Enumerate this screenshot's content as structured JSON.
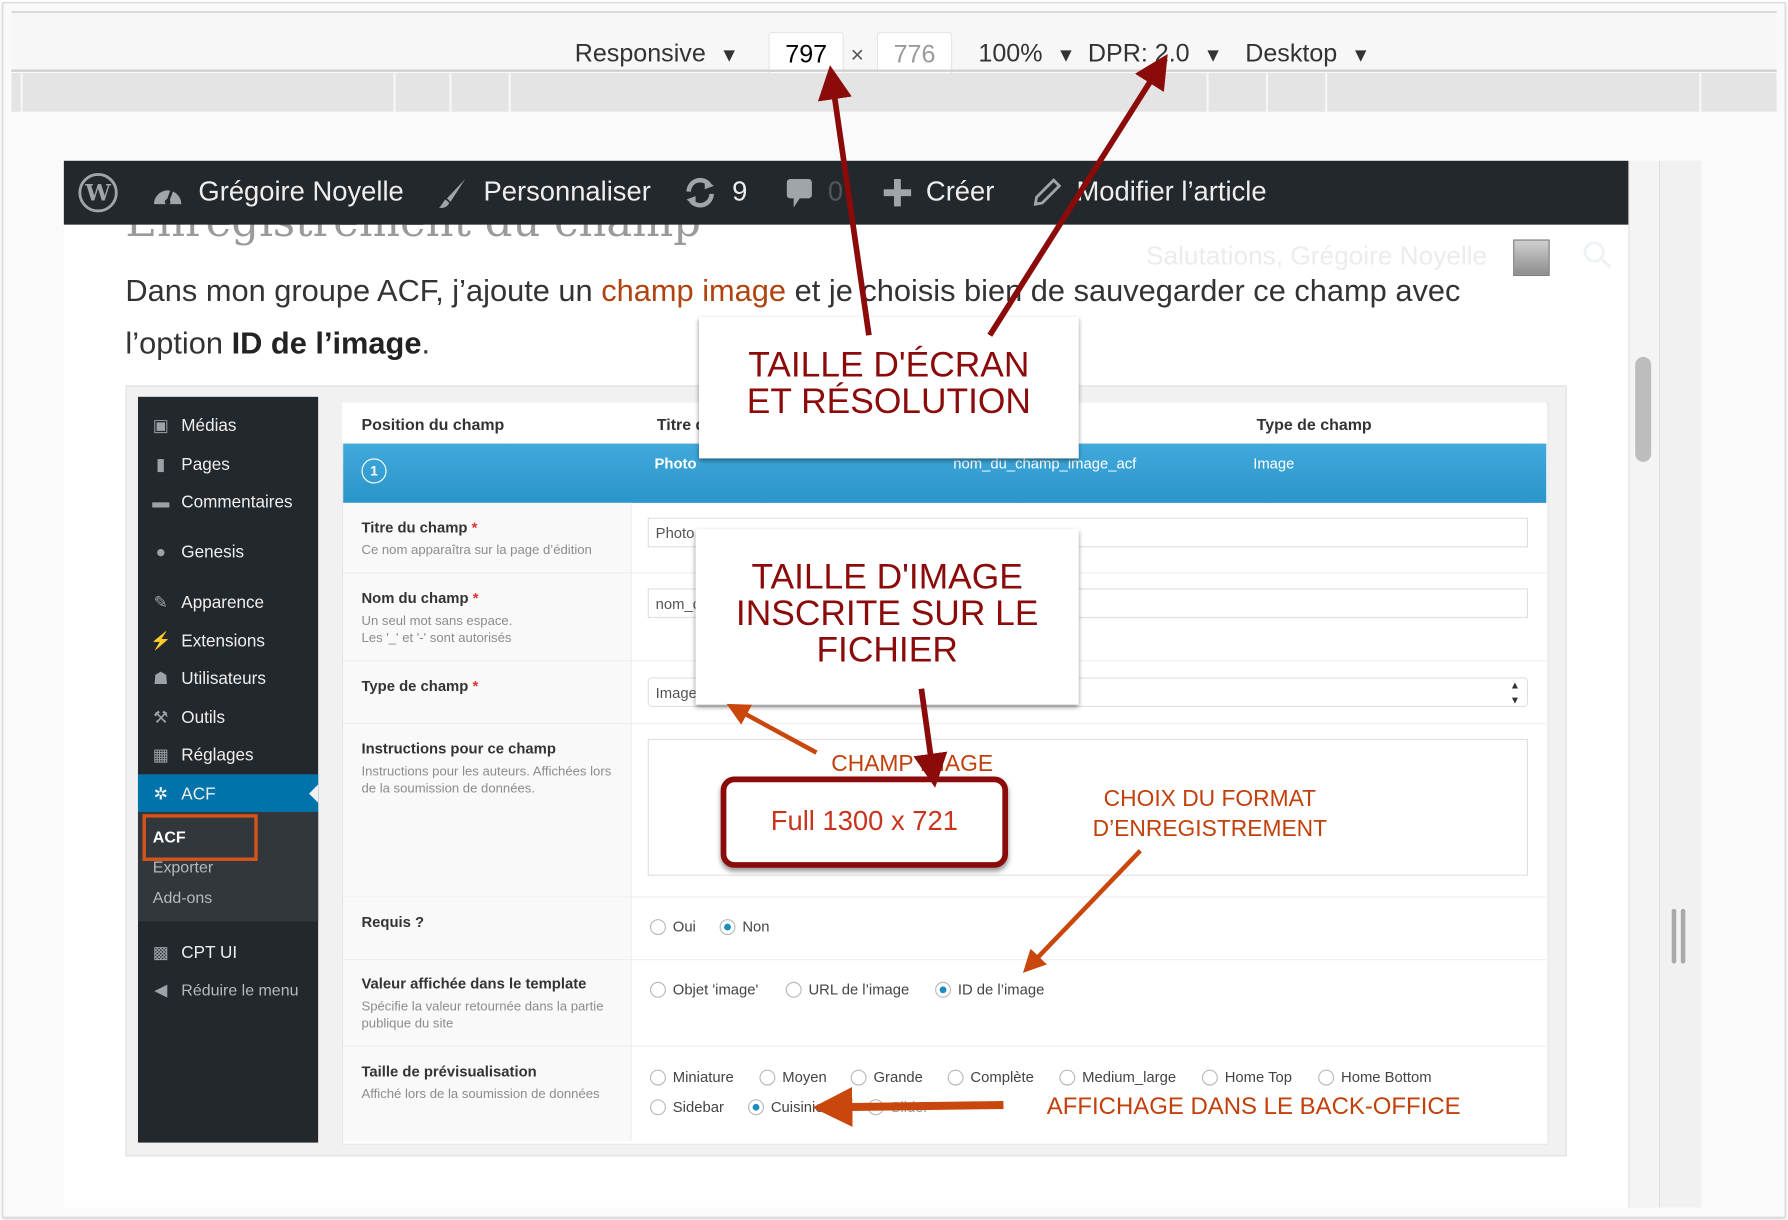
{
  "devtools": {
    "device_mode": "Responsive",
    "width_value": "797",
    "times_sign": "×",
    "height_value": "776",
    "zoom": "100%",
    "dpr": "DPR: 2.0",
    "device_type": "Desktop",
    "dropdown_glyph": "▼"
  },
  "adminbar": {
    "site_name": "Grégoire Noyelle",
    "customize": "Personnaliser",
    "updates_count": "9",
    "comments_count": "0",
    "new": "Créer",
    "edit": "Modifier l’article"
  },
  "article": {
    "heading": "Enregistrement du champ",
    "greeting": "Salutations, Grégoire Noyelle",
    "para_part1": "Dans mon groupe ACF, j’ajoute un ",
    "para_link": "champ image",
    "para_part2": " et je choisis bien de sauvegarder ce champ avec l’option ",
    "para_bold": "ID de l’image",
    "para_end": "."
  },
  "wp_menu": {
    "items": [
      {
        "label": "Médias",
        "icon": "media-icon"
      },
      {
        "label": "Pages",
        "icon": "pages-icon"
      },
      {
        "label": "Commentaires",
        "icon": "comments-icon"
      },
      {
        "label": "Genesis",
        "icon": "genesis-icon"
      },
      {
        "label": "Apparence",
        "icon": "appearance-icon"
      },
      {
        "label": "Extensions",
        "icon": "plugins-icon"
      },
      {
        "label": "Utilisateurs",
        "icon": "users-icon"
      },
      {
        "label": "Outils",
        "icon": "tools-icon"
      },
      {
        "label": "Réglages",
        "icon": "settings-icon"
      },
      {
        "label": "ACF",
        "icon": "gear-icon",
        "active": true
      }
    ],
    "submenu": [
      "ACF",
      "Exporter",
      "Add-ons"
    ],
    "cpt_ui": "CPT UI",
    "collapse": "Réduire le menu"
  },
  "acf": {
    "headers": [
      "Position du champ",
      "Titre du champ",
      "Type de champ"
    ],
    "field_row": {
      "order": "1",
      "title": "Photo",
      "name": "nom_du_champ_image_acf",
      "type": "Image"
    },
    "fields": {
      "title_label": "Titre du champ",
      "title_desc": "Ce nom apparaîtra sur la page d’édition",
      "title_value": "Photo",
      "name_label": "Nom du champ",
      "name_desc1": "Un seul mot sans espace.",
      "name_desc2": "Les '_' et '-' sont autorisés",
      "name_value": "nom_du_champ_image_acf",
      "type_label": "Type de champ",
      "type_value": "Image",
      "instructions_label": "Instructions pour ce champ",
      "instructions_desc": "Instructions pour les auteurs. Affichées lors de la soumission de données.",
      "required_label": "Requis ?",
      "required_options": [
        "Oui",
        "Non"
      ],
      "required_selected": "Non",
      "return_label": "Valeur affichée dans le template",
      "return_desc": "Spécifie la valeur retournée dans la partie publique du site",
      "return_options": [
        "Objet 'image'",
        "URL de l’image",
        "ID de l’image"
      ],
      "return_selected": "ID de l’image",
      "preview_label": "Taille de prévisualisation",
      "preview_desc": "Affiché lors de la soumission de données",
      "preview_options_row1": [
        "Miniature",
        "Moyen",
        "Grande",
        "Complète",
        "Medium_large",
        "Home Top",
        "Home Bottom"
      ],
      "preview_options_row2": [
        "Sidebar",
        "Cuisinier",
        "Slider"
      ],
      "preview_selected": "Cuisinier"
    }
  },
  "annotations": {
    "screen_size": "TAILLE D'ÉCRAN ET RÉSOLUTION",
    "image_size": "TAILLE D'IMAGE INSCRITE SUR LE FICHIER",
    "champ_image": "CHAMP IMAGE",
    "full_size": "Full 1300 x 721",
    "format_choice_1": "CHOIX DU FORMAT",
    "format_choice_2": "D’ENREGISTREMENT",
    "backoffice": "AFFICHAGE DANS LE BACK-OFFICE"
  },
  "colors": {
    "annotation_dark_red": "#8b0a0a",
    "annotation_orange": "#c2400b",
    "wp_admin_bar": "#23282d",
    "wp_active_blue": "#0073aa",
    "acf_row_blue": "#2a95c9",
    "link_color": "#b1430f"
  }
}
